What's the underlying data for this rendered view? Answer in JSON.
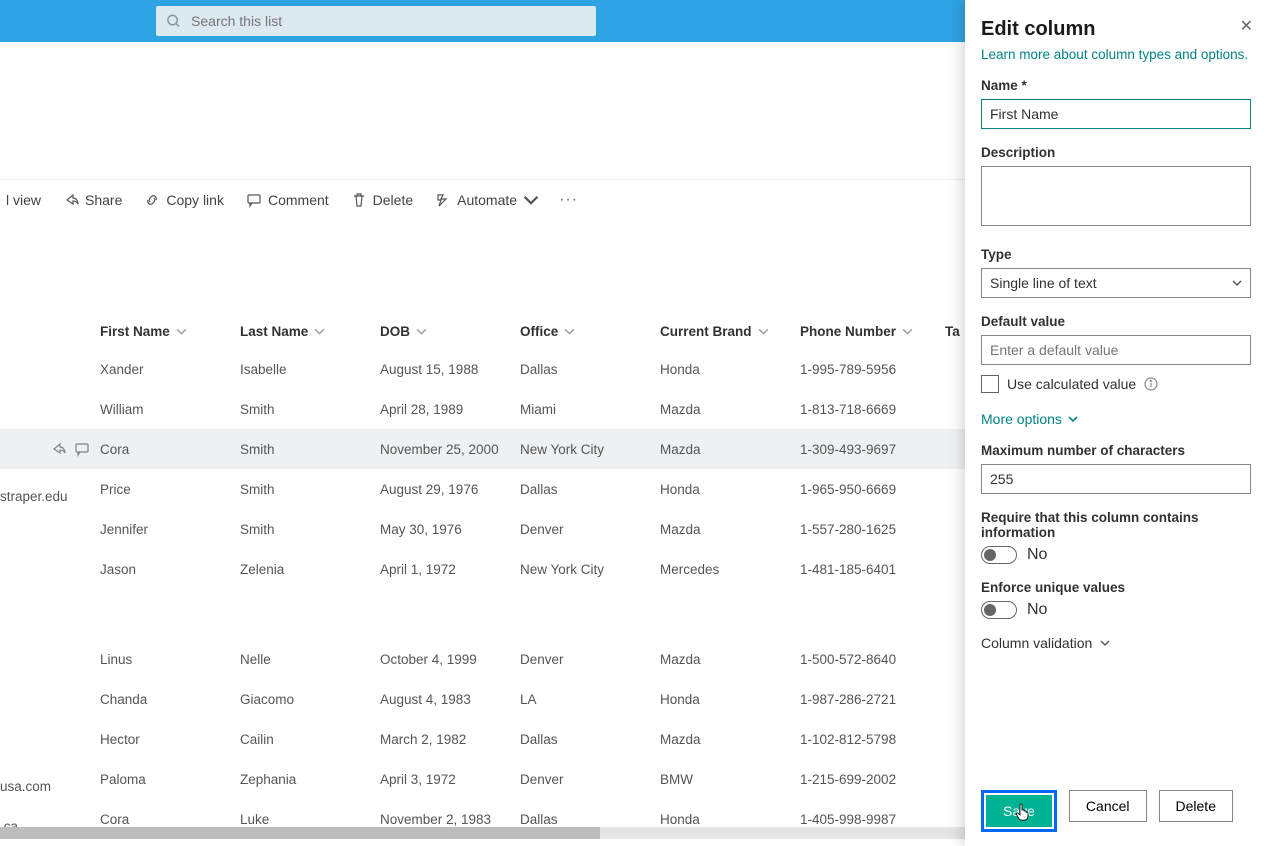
{
  "search": {
    "placeholder": "Search this list"
  },
  "commands": {
    "view": "l view",
    "share": "Share",
    "copy_link": "Copy link",
    "comment": "Comment",
    "delete": "Delete",
    "automate": "Automate"
  },
  "columns": {
    "first_name": "First Name",
    "last_name": "Last Name",
    "dob": "DOB",
    "office": "Office",
    "current_brand": "Current Brand",
    "phone": "Phone Number",
    "tag_partial": "Ta"
  },
  "rows": [
    {
      "first": "Xander",
      "last": "Isabelle",
      "dob": "August 15, 1988",
      "office": "Dallas",
      "brand": "Honda",
      "phone": "1-995-789-5956",
      "email_partial": ""
    },
    {
      "first": "William",
      "last": "Smith",
      "dob": "April 28, 1989",
      "office": "Miami",
      "brand": "Mazda",
      "phone": "1-813-718-6669",
      "email_partial": ""
    },
    {
      "first": "Cora",
      "last": "Smith",
      "dob": "November 25, 2000",
      "office": "New York City",
      "brand": "Mazda",
      "phone": "1-309-493-9697",
      "email_partial": "",
      "selected": true
    },
    {
      "first": "Price",
      "last": "Smith",
      "dob": "August 29, 1976",
      "office": "Dallas",
      "brand": "Honda",
      "phone": "1-965-950-6669",
      "email_partial": "straper.edu"
    },
    {
      "first": "Jennifer",
      "last": "Smith",
      "dob": "May 30, 1976",
      "office": "Denver",
      "brand": "Mazda",
      "phone": "1-557-280-1625",
      "email_partial": ""
    },
    {
      "first": "Jason",
      "last": "Zelenia",
      "dob": "April 1, 1972",
      "office": "New York City",
      "brand": "Mercedes",
      "phone": "1-481-185-6401",
      "email_partial": ""
    }
  ],
  "rows2": [
    {
      "first": "Linus",
      "last": "Nelle",
      "dob": "October 4, 1999",
      "office": "Denver",
      "brand": "Mazda",
      "phone": "1-500-572-8640",
      "email_partial": ""
    },
    {
      "first": "Chanda",
      "last": "Giacomo",
      "dob": "August 4, 1983",
      "office": "LA",
      "brand": "Honda",
      "phone": "1-987-286-2721",
      "email_partial": ""
    },
    {
      "first": "Hector",
      "last": "Cailin",
      "dob": "March 2, 1982",
      "office": "Dallas",
      "brand": "Mazda",
      "phone": "1-102-812-5798",
      "email_partial": ""
    },
    {
      "first": "Paloma",
      "last": "Zephania",
      "dob": "April 3, 1972",
      "office": "Denver",
      "brand": "BMW",
      "phone": "1-215-699-2002",
      "email_partial": "usa.com"
    },
    {
      "first": "Cora",
      "last": "Luke",
      "dob": "November 2, 1983",
      "office": "Dallas",
      "brand": "Honda",
      "phone": "1-405-998-9987",
      "email_partial": ".ca"
    }
  ],
  "panel": {
    "title": "Edit column",
    "learn_more": "Learn more about column types and options.",
    "name_label": "Name *",
    "name_value": "First Name",
    "description_label": "Description",
    "type_label": "Type",
    "type_value": "Single line of text",
    "default_label": "Default value",
    "default_placeholder": "Enter a default value",
    "use_calc": "Use calculated value",
    "more_options": "More options",
    "max_chars_label": "Maximum number of characters",
    "max_chars_value": "255",
    "require_label": "Require that this column contains information",
    "no": "No",
    "unique_label": "Enforce unique values",
    "validation": "Column validation",
    "save": "Save",
    "cancel": "Cancel",
    "delete": "Delete"
  }
}
